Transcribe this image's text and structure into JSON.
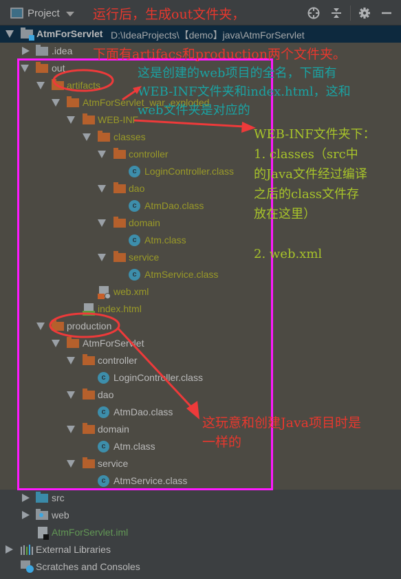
{
  "header": {
    "title": "Project",
    "icons": [
      "locate-icon",
      "collapse-all-icon",
      "settings-gear-icon",
      "hide-minimize-icon"
    ]
  },
  "tree": {
    "root": {
      "name": "AtmForServlet",
      "path": "D:\\IdeaProjects\\【demo】java\\AtmForServlet"
    },
    "idea": ".idea",
    "out": "out",
    "artifacts": "artifacts",
    "exploded": "AtmForServlet_war_exploded",
    "webinf": "WEB-INF",
    "classes": "classes",
    "a_controller": "controller",
    "a_login": "LoginController.class",
    "a_dao": "dao",
    "a_atmdao": "AtmDao.class",
    "a_domain": "domain",
    "a_atm": "Atm.class",
    "a_service": "service",
    "a_atmservice": "AtmService.class",
    "webxml": "web.xml",
    "indexhtml": "index.html",
    "production": "production",
    "p_module": "AtmForServlet",
    "p_controller": "controller",
    "p_login": "LoginController.class",
    "p_dao": "dao",
    "p_atmdao": "AtmDao.class",
    "p_domain": "domain",
    "p_atm": "Atm.class",
    "p_service": "service",
    "p_atmservice": "AtmService.class",
    "src": "src",
    "web": "web",
    "iml": "AtmForServlet.iml",
    "external": "External Libraries",
    "scratches": "Scratches and Consoles"
  },
  "annotations": {
    "top1": "运行后，生成out文件夹，",
    "top2": "下面有artifacs和production两个文件夹。",
    "teal": [
      "这是创建的web项目的全名，下面有",
      "WEB-INF文件夹和index.html，这和",
      "web文件夹是对应的"
    ],
    "lime": [
      "WEB-INF文件夹下：",
      "1. classes（src中",
      "的Java文件经过编译",
      "之后的class文件存",
      "放在这里）",
      "",
      "2. web.xml"
    ],
    "bottom": [
      "这玩意和创建Java项目时是",
      "一样的"
    ]
  },
  "colors": {
    "background": "#4c4a43",
    "panel": "#3c3f41",
    "selected_row": "#0d293e",
    "annotation_red": "#e8382e",
    "annotation_teal": "#1aa3a3",
    "annotation_lime": "#a8c42a",
    "frame_magenta": "#ff19ff",
    "excluded_text": "#9a9a28"
  }
}
